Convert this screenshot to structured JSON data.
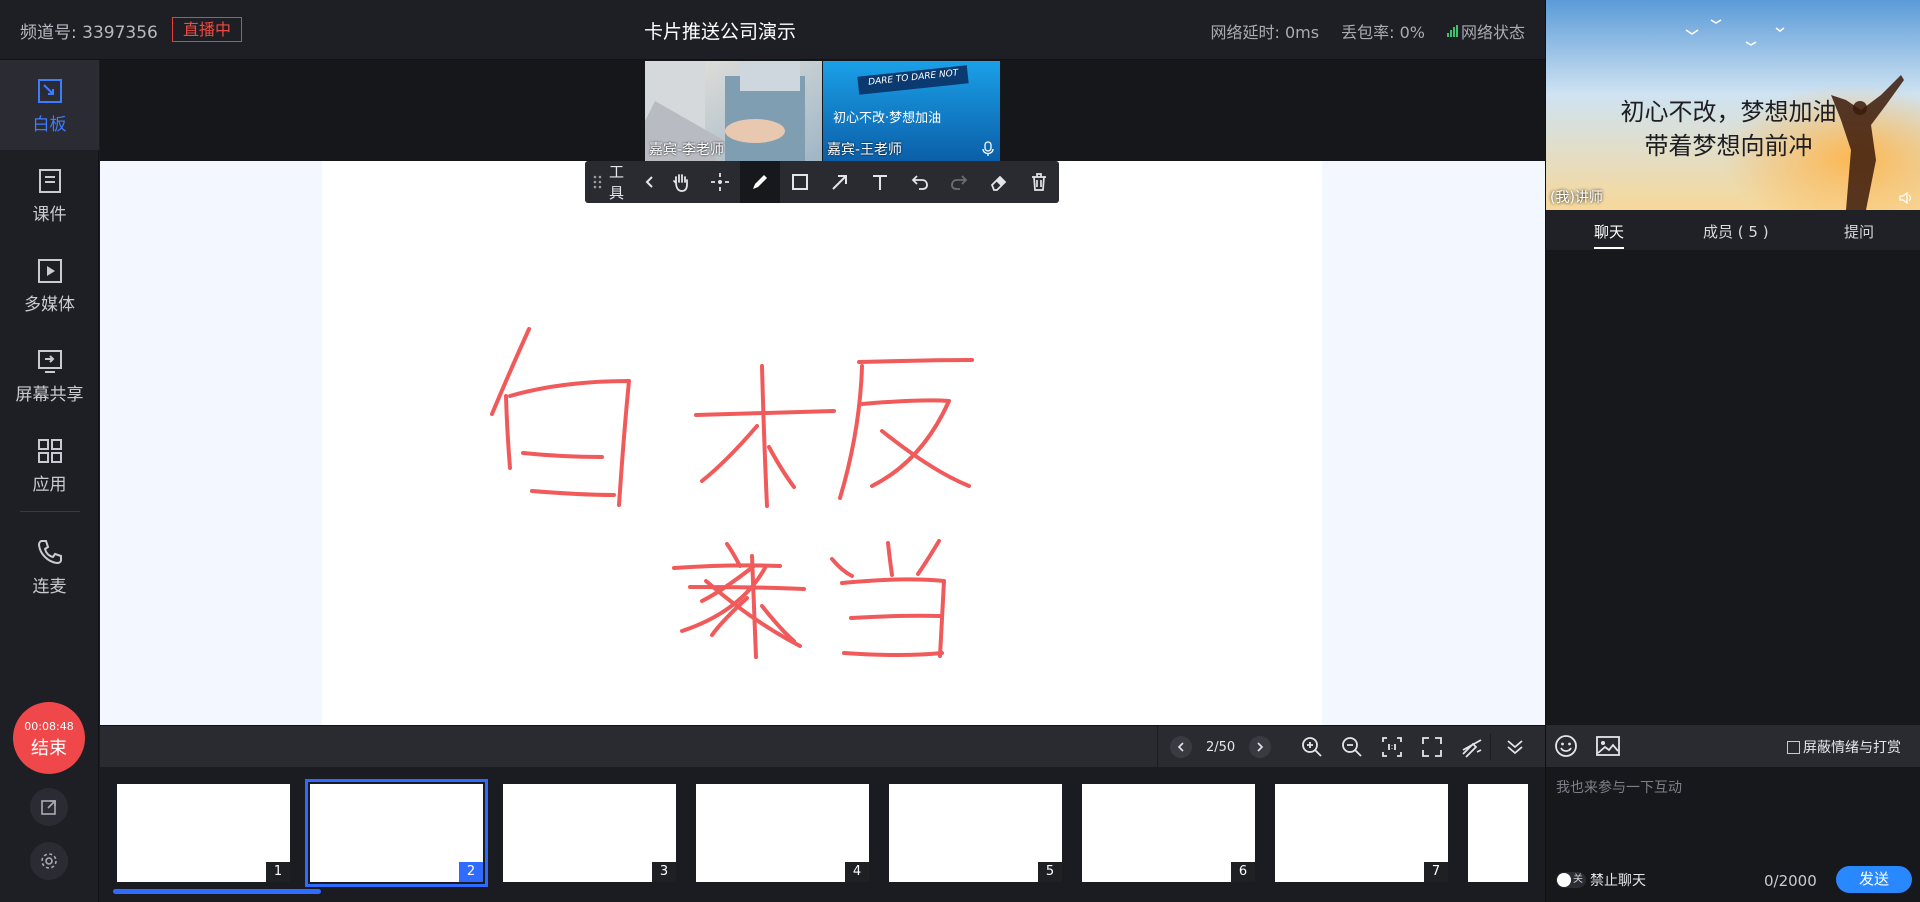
{
  "topbar": {
    "channel": "频道号: 3397356",
    "live_status": "直播中",
    "title": "卡片推送公司演示",
    "latency": "网络延时: 0ms",
    "packet_loss": "丢包率: 0%",
    "net_status": "网络状态"
  },
  "nav": {
    "items": [
      {
        "label": "白板",
        "icon": "whiteboard-icon"
      },
      {
        "label": "课件",
        "icon": "courseware-icon"
      },
      {
        "label": "多媒体",
        "icon": "media-icon"
      },
      {
        "label": "屏幕共享",
        "icon": "screen-share-icon"
      },
      {
        "label": "应用",
        "icon": "apps-icon"
      },
      {
        "label": "连麦",
        "icon": "phone-icon"
      }
    ],
    "timer": "00:08:48",
    "end_label": "结束"
  },
  "guests": [
    {
      "name": "嘉宾-李老师"
    },
    {
      "name": "嘉宾-王老师",
      "overlay": "初心不改·梦想加油",
      "banner_text": "DARE TO DARE NOT"
    }
  ],
  "toolbar": {
    "label": "工具",
    "tools": [
      "hand-icon",
      "laser-pointer-icon",
      "pen-icon",
      "rectangle-icon",
      "arrow-icon",
      "text-icon",
      "undo-icon",
      "redo-icon",
      "eraser-icon",
      "delete-icon"
    ],
    "active_tool": "pen-icon"
  },
  "whiteboard": {
    "stroke_color": "#f05a5a"
  },
  "pager": {
    "current": "2/50"
  },
  "thumbnails": {
    "pages": [
      "1",
      "2",
      "3",
      "4",
      "5",
      "6",
      "7"
    ],
    "selected": "2"
  },
  "host": {
    "line1": "初心不改，梦想加油",
    "line2": "带着梦想向前冲",
    "label": "(我)讲师"
  },
  "tabs": {
    "chat": "聊天",
    "members": "成员 ( 5 )",
    "questions": "提问"
  },
  "chat": {
    "hide_effects_label": "屏蔽情绪与打赏",
    "placeholder": "我也来参与一下互动",
    "switch_state": "关",
    "mute_label": "禁止聊天",
    "counter": "0/2000",
    "send_label": "发送"
  },
  "colors": {
    "accent": "#2f6bff",
    "live": "#ec4a43",
    "end_button": "#f0484a",
    "send_button": "#2a88ff"
  }
}
